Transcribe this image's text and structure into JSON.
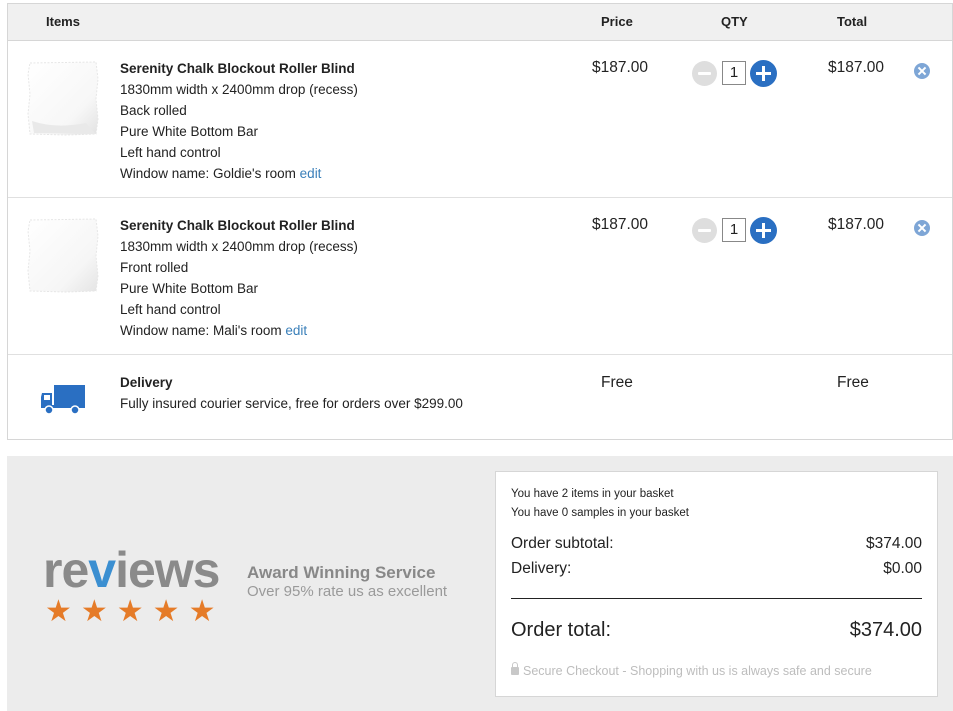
{
  "header": {
    "items": "Items",
    "price": "Price",
    "qty": "QTY",
    "total": "Total"
  },
  "cart": {
    "items": [
      {
        "title": "Serenity Chalk Blockout Roller Blind",
        "size": "1830mm width x 2400mm drop (recess)",
        "roll": "Back rolled",
        "bar": "Pure White Bottom Bar",
        "control": "Left hand control",
        "window_prefix": "Window name: Goldie's room",
        "edit": "edit",
        "price": "$187.00",
        "qty": "1",
        "total": "$187.00"
      },
      {
        "title": "Serenity Chalk Blockout Roller Blind",
        "size": "1830mm width x 2400mm drop (recess)",
        "roll": "Front rolled",
        "bar": "Pure White Bottom Bar",
        "control": "Left hand control",
        "window_prefix": "Window name: Mali's room",
        "edit": "edit",
        "price": "$187.00",
        "qty": "1",
        "total": "$187.00"
      }
    ],
    "delivery": {
      "title": "Delivery",
      "description": "Fully insured courier service, free for orders over $299.00",
      "price": "Free",
      "total": "Free",
      "icon": "truck-icon"
    }
  },
  "reviews": {
    "logo_pre": "re",
    "logo_v": "v",
    "logo_post": "iews",
    "stars": "★★★★★",
    "rating": 5,
    "award_title": "Award Winning Service",
    "award_sub": "Over 95% rate us as excellent"
  },
  "summary": {
    "items_note": "You have 2 items in your basket",
    "samples_note": "You have 0 samples in your basket",
    "subtotal_label": "Order subtotal:",
    "subtotal_value": "$374.00",
    "delivery_label": "Delivery:",
    "delivery_value": "$0.00",
    "total_label": "Order total:",
    "total_value": "$374.00",
    "secure_text": "Secure Checkout - Shopping with us is always safe and secure"
  },
  "colors": {
    "accent_blue": "#2a6fc2",
    "link_blue": "#3a7fb9",
    "star_orange": "#e57b28",
    "panel_grey": "#ececec"
  }
}
